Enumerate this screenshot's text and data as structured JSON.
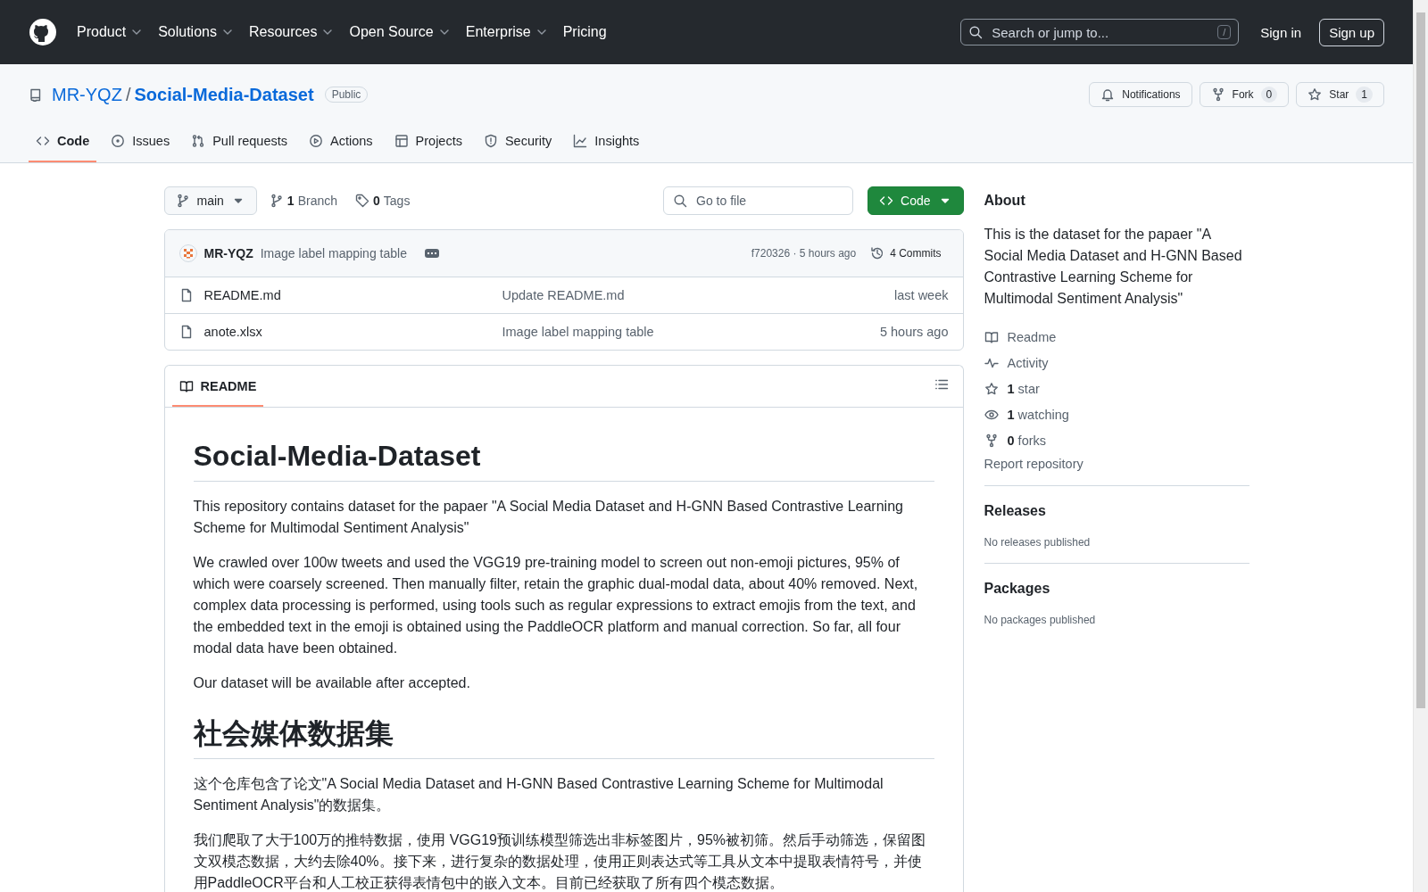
{
  "header": {
    "nav": [
      {
        "label": "Product",
        "dropdown": true
      },
      {
        "label": "Solutions",
        "dropdown": true
      },
      {
        "label": "Resources",
        "dropdown": true
      },
      {
        "label": "Open Source",
        "dropdown": true
      },
      {
        "label": "Enterprise",
        "dropdown": true
      },
      {
        "label": "Pricing",
        "dropdown": false
      }
    ],
    "search": {
      "placeholder": "Search or jump to...",
      "shortcut": "/"
    },
    "sign_in": "Sign in",
    "sign_up": "Sign up"
  },
  "repo": {
    "owner": "MR-YQZ",
    "separator": "/",
    "name": "Social-Media-Dataset",
    "visibility": "Public",
    "actions": [
      {
        "kind": "notifications",
        "label": "Notifications"
      },
      {
        "kind": "fork",
        "label": "Fork",
        "count": "0"
      },
      {
        "kind": "star",
        "label": "Star",
        "count": "1"
      }
    ],
    "tabs": [
      {
        "kind": "code",
        "label": "Code",
        "selected": true
      },
      {
        "kind": "issues",
        "label": "Issues",
        "selected": false
      },
      {
        "kind": "pulls",
        "label": "Pull requests",
        "selected": false
      },
      {
        "kind": "actions",
        "label": "Actions",
        "selected": false
      },
      {
        "kind": "projects",
        "label": "Projects",
        "selected": false
      },
      {
        "kind": "security",
        "label": "Security",
        "selected": false
      },
      {
        "kind": "insights",
        "label": "Insights",
        "selected": false
      }
    ]
  },
  "file_browser": {
    "branch": "main",
    "branches": {
      "count": "1",
      "label": "Branch"
    },
    "tags": {
      "count": "0",
      "label": "Tags"
    },
    "go_to_file": {
      "placeholder": "Go to file"
    },
    "code_button": "Code",
    "latest_commit": {
      "author": "MR-YQZ",
      "message": "Image label mapping table",
      "hash_time": "f720326 · 5 hours ago",
      "commits": "4 Commits"
    },
    "files": [
      {
        "name": "README.md",
        "message": "Update README.md",
        "time": "last week"
      },
      {
        "name": "anote.xlsx",
        "message": "Image label mapping table",
        "time": "5 hours ago"
      }
    ]
  },
  "readme": {
    "tab": "README",
    "blocks": [
      {
        "kind": "heading",
        "text": "Social-Media-Dataset"
      },
      {
        "kind": "paragraph",
        "text": "This repository contains dataset for the papaer \"A Social Media Dataset and H-GNN Based Contrastive Learning Scheme for Multimodal Sentiment Analysis\""
      },
      {
        "kind": "paragraph",
        "text": "We crawled over 100w tweets and used the VGG19 pre-training model to screen out non-emoji pictures, 95% of which were coarsely screened. Then manually filter, retain the graphic dual-modal data, about 40% removed. Next, complex data processing is performed, using tools such as regular expressions to extract emojis from the text, and the embedded text in the emoji is obtained using the PaddleOCR platform and manual correction. So far, all four modal data have been obtained."
      },
      {
        "kind": "paragraph",
        "text": "Our dataset will be available after accepted."
      },
      {
        "kind": "heading",
        "text": "社会媒体数据集"
      },
      {
        "kind": "paragraph",
        "text": "这个仓库包含了论文\"A Social Media Dataset and H-GNN Based Contrastive Learning Scheme for Multimodal Sentiment Analysis\"的数据集。"
      },
      {
        "kind": "paragraph",
        "text": "我们爬取了大于100万的推特数据，使用 VGG19预训练模型筛选出非标签图片，95%被初筛。然后手动筛选，保留图文双模态数据，大约去除40%。接下来，进行复杂的数据处理，使用正则表达式等工具从文本中提取表情符号，并使用PaddleOCR平台和人工校正获得表情包中的嵌入文本。目前已经获取了所有四个模态数据。"
      }
    ]
  },
  "sidebar": {
    "about": {
      "heading": "About",
      "description": "This is the dataset for the papaer \"A Social Media Dataset and H-GNN Based Contrastive Learning Scheme for Multimodal Sentiment Analysis\"",
      "links": [
        {
          "kind": "readme",
          "label": "Readme"
        },
        {
          "kind": "activity",
          "label": "Activity"
        },
        {
          "kind": "stars",
          "count": "1",
          "label": "star"
        },
        {
          "kind": "watching",
          "count": "1",
          "label": "watching"
        },
        {
          "kind": "forks",
          "count": "0",
          "label": "forks"
        }
      ],
      "report": "Report repository"
    },
    "releases": {
      "heading": "Releases",
      "empty": "No releases published"
    },
    "packages": {
      "heading": "Packages",
      "empty": "No packages published"
    }
  }
}
